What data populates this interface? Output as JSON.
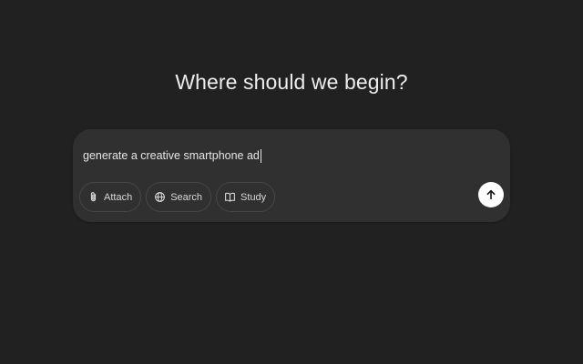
{
  "heading": "Where should we begin?",
  "composer": {
    "input_value": "generate a creative smartphone ad",
    "tools": [
      {
        "label": "Attach",
        "icon": "paperclip-icon"
      },
      {
        "label": "Search",
        "icon": "globe-icon"
      },
      {
        "label": "Study",
        "icon": "book-icon"
      }
    ],
    "send_icon": "arrow-up-icon"
  },
  "colors": {
    "background": "#212121",
    "composer": "#303030",
    "text": "#ececec",
    "send_button": "#ffffff"
  }
}
